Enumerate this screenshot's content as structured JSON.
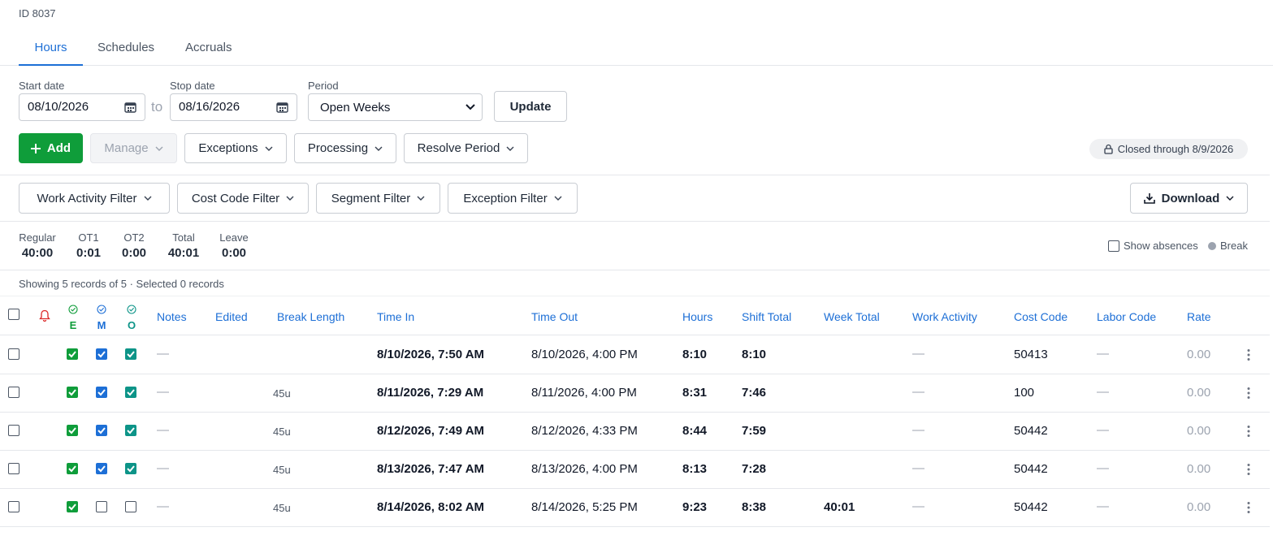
{
  "employee": {
    "id_text": "ID 8037"
  },
  "tabs": [
    {
      "label": "Hours"
    },
    {
      "label": "Schedules"
    },
    {
      "label": "Accruals"
    }
  ],
  "filters": {
    "start_label": "Start date",
    "start_value": "08/10/2026",
    "to_text": "to",
    "stop_label": "Stop date",
    "stop_value": "08/16/2026",
    "period_label": "Period",
    "period_value": "Open Weeks",
    "update_label": "Update"
  },
  "toolbar": {
    "add_label": "Add",
    "manage_label": "Manage",
    "exceptions_label": "Exceptions",
    "processing_label": "Processing",
    "resolve_label": "Resolve Period",
    "closed_text": "Closed through 8/9/2026"
  },
  "filter_bar": {
    "work_activity": "Work Activity Filter",
    "cost_code": "Cost Code Filter",
    "segment": "Segment Filter",
    "exception": "Exception Filter",
    "download": "Download"
  },
  "summary": [
    {
      "label": "Regular",
      "value": "40:00"
    },
    {
      "label": "OT1",
      "value": "0:01"
    },
    {
      "label": "OT2",
      "value": "0:00"
    },
    {
      "label": "Total",
      "value": "40:01"
    },
    {
      "label": "Leave",
      "value": "0:00"
    }
  ],
  "show_absences_label": "Show absences",
  "break_label": "Break",
  "records_text": "Showing 5 records of 5 · Selected 0 records",
  "columns": {
    "e": "E",
    "m": "M",
    "o": "O",
    "notes": "Notes",
    "edited": "Edited",
    "break_length": "Break Length",
    "time_in": "Time In",
    "time_out": "Time Out",
    "hours": "Hours",
    "shift_total": "Shift Total",
    "week_total": "Week Total",
    "work_activity": "Work Activity",
    "cost_code": "Cost Code",
    "labor_code": "Labor Code",
    "rate": "Rate"
  },
  "colors": {
    "accent": "#1d6fd6",
    "primary": "#0f9d3a",
    "teal": "#0d9488",
    "alert": "#dc2626"
  },
  "rows": [
    {
      "e": true,
      "m": true,
      "o": true,
      "notes": "—",
      "break": "",
      "time_in": "8/10/2026, 7:50 AM",
      "time_out": "8/10/2026, 4:00 PM",
      "hours": "8:10",
      "shift_total": "8:10",
      "week_total": "",
      "work_activity": "—",
      "cost_code": "50413",
      "labor_code": "—",
      "rate": "0.00"
    },
    {
      "e": true,
      "m": true,
      "o": true,
      "notes": "—",
      "break": "45u",
      "time_in": "8/11/2026, 7:29 AM",
      "time_out": "8/11/2026, 4:00 PM",
      "hours": "8:31",
      "shift_total": "7:46",
      "week_total": "",
      "work_activity": "—",
      "cost_code": "100",
      "labor_code": "—",
      "rate": "0.00"
    },
    {
      "e": true,
      "m": true,
      "o": true,
      "notes": "—",
      "break": "45u",
      "time_in": "8/12/2026, 7:49 AM",
      "time_out": "8/12/2026, 4:33 PM",
      "hours": "8:44",
      "shift_total": "7:59",
      "week_total": "",
      "work_activity": "—",
      "cost_code": "50442",
      "labor_code": "—",
      "rate": "0.00"
    },
    {
      "e": true,
      "m": true,
      "o": true,
      "notes": "—",
      "break": "45u",
      "time_in": "8/13/2026, 7:47 AM",
      "time_out": "8/13/2026, 4:00 PM",
      "hours": "8:13",
      "shift_total": "7:28",
      "week_total": "",
      "work_activity": "—",
      "cost_code": "50442",
      "labor_code": "—",
      "rate": "0.00"
    },
    {
      "e": true,
      "m": false,
      "o": false,
      "notes": "—",
      "break": "45u",
      "time_in": "8/14/2026, 8:02 AM",
      "time_out": "8/14/2026, 5:25 PM",
      "hours": "9:23",
      "shift_total": "8:38",
      "week_total": "40:01",
      "work_activity": "—",
      "cost_code": "50442",
      "labor_code": "—",
      "rate": "0.00"
    }
  ]
}
